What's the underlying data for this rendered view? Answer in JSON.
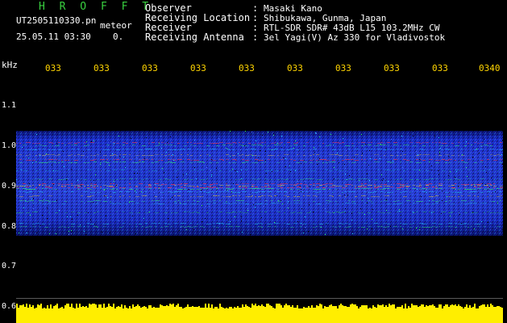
{
  "header": {
    "app_title": "H R O F F T",
    "file_name": "UT2505110330.pn",
    "kind_label": "meteor",
    "date_time": "25.05.11 03:30",
    "extra_value": "0.",
    "title_color": "#39d040"
  },
  "info": [
    {
      "label": "Observer",
      "value": "Masaki Kano"
    },
    {
      "label": "Receiving Location",
      "value": "Shibukawa, Gunma, Japan"
    },
    {
      "label": "Receiver",
      "value": "RTL-SDR SDR# 43dB L15 103.2MHz CW"
    },
    {
      "label": "Receiving Antenna",
      "value": "3el Yagi(V) Az 330 for Vladivostok"
    }
  ],
  "info_separator": ":",
  "axis": {
    "unit": "kHz",
    "time_labels": [
      "033",
      "033",
      "033",
      "033",
      "033",
      "033",
      "033",
      "033",
      "033",
      "0340"
    ],
    "freq_labels": [
      "1.1",
      "1.0",
      "0.9",
      "0.8",
      "0.7",
      "0.6"
    ],
    "label_color": "#ffd500"
  },
  "spectrogram": {
    "band_color": "#1a2cc8",
    "highlight_color": "#ff2030",
    "level_color": "#ffee00"
  }
}
